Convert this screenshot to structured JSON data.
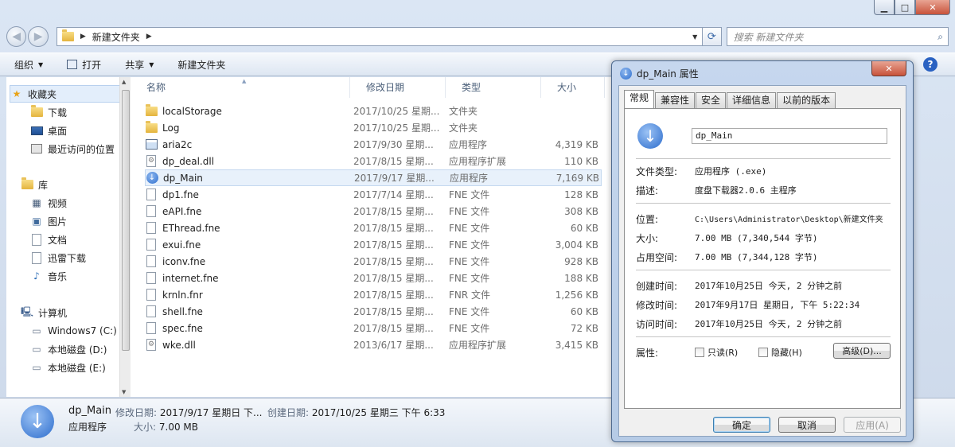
{
  "address": {
    "path": "新建文件夹"
  },
  "search": {
    "placeholder": "搜索 新建文件夹"
  },
  "toolbar": {
    "organize": "组织",
    "open": "打开",
    "share": "共享",
    "new_folder": "新建文件夹"
  },
  "nav": {
    "favorites": "收藏夹",
    "downloads": "下载",
    "desktop": "桌面",
    "recent": "最近访问的位置",
    "libraries": "库",
    "videos": "视频",
    "pictures": "图片",
    "documents": "文档",
    "thunder": "迅雷下载",
    "music": "音乐",
    "computer": "计算机",
    "drive_c": "Windows7 (C:)",
    "drive_d": "本地磁盘 (D:)",
    "drive_e": "本地磁盘 (E:)"
  },
  "columns": {
    "name": "名称",
    "date": "修改日期",
    "type": "类型",
    "size": "大小"
  },
  "files": [
    {
      "name": "localStorage",
      "date": "2017/10/25 星期...",
      "type": "文件夹",
      "size": "",
      "icon": "folder-icon"
    },
    {
      "name": "Log",
      "date": "2017/10/25 星期...",
      "type": "文件夹",
      "size": "",
      "icon": "folder-icon"
    },
    {
      "name": "aria2c",
      "date": "2017/9/30 星期...",
      "type": "应用程序",
      "size": "4,319 KB",
      "icon": "application-icon"
    },
    {
      "name": "dp_deal.dll",
      "date": "2017/8/15 星期...",
      "type": "应用程序扩展",
      "size": "110 KB",
      "icon": "dll-icon"
    },
    {
      "name": "dp_Main",
      "date": "2017/9/17 星期...",
      "type": "应用程序",
      "size": "7,169 KB",
      "icon": "download-app-icon"
    },
    {
      "name": "dp1.fne",
      "date": "2017/7/14 星期...",
      "type": "FNE 文件",
      "size": "128 KB",
      "icon": "file-icon"
    },
    {
      "name": "eAPI.fne",
      "date": "2017/8/15 星期...",
      "type": "FNE 文件",
      "size": "308 KB",
      "icon": "file-icon"
    },
    {
      "name": "EThread.fne",
      "date": "2017/8/15 星期...",
      "type": "FNE 文件",
      "size": "60 KB",
      "icon": "file-icon"
    },
    {
      "name": "exui.fne",
      "date": "2017/8/15 星期...",
      "type": "FNE 文件",
      "size": "3,004 KB",
      "icon": "file-icon"
    },
    {
      "name": "iconv.fne",
      "date": "2017/8/15 星期...",
      "type": "FNE 文件",
      "size": "928 KB",
      "icon": "file-icon"
    },
    {
      "name": "internet.fne",
      "date": "2017/8/15 星期...",
      "type": "FNE 文件",
      "size": "188 KB",
      "icon": "file-icon"
    },
    {
      "name": "krnln.fnr",
      "date": "2017/8/15 星期...",
      "type": "FNR 文件",
      "size": "1,256 KB",
      "icon": "file-icon"
    },
    {
      "name": "shell.fne",
      "date": "2017/8/15 星期...",
      "type": "FNE 文件",
      "size": "60 KB",
      "icon": "file-icon"
    },
    {
      "name": "spec.fne",
      "date": "2017/8/15 星期...",
      "type": "FNE 文件",
      "size": "72 KB",
      "icon": "file-icon"
    },
    {
      "name": "wke.dll",
      "date": "2013/6/17 星期...",
      "type": "应用程序扩展",
      "size": "3,415 KB",
      "icon": "dll-icon"
    }
  ],
  "details": {
    "name": "dp_Main",
    "type": "应用程序",
    "modified_label": "修改日期:",
    "modified": "2017/9/17 星期日 下...",
    "created_label": "创建日期:",
    "created": "2017/10/25 星期三 下午 6:33",
    "size_label": "大小:",
    "size": "7.00 MB"
  },
  "dialog": {
    "title": "dp_Main 属性",
    "tabs": [
      "常规",
      "兼容性",
      "安全",
      "详细信息",
      "以前的版本"
    ],
    "filename": "dp_Main",
    "rows": {
      "type_k": "文件类型:",
      "type_v": "应用程序 (.exe)",
      "desc_k": "描述:",
      "desc_v": "度盘下载器2.0.6 主程序",
      "loc_k": "位置:",
      "loc_v": "C:\\Users\\Administrator\\Desktop\\新建文件夹",
      "size_k": "大小:",
      "size_v": "7.00 MB (7,340,544 字节)",
      "disk_k": "占用空间:",
      "disk_v": "7.00 MB (7,344,128 字节)",
      "created_k": "创建时间:",
      "created_v": "2017年10月25日 今天, 2 分钟之前",
      "modified_k": "修改时间:",
      "modified_v": "2017年9月17日 星期日, 下午 5:22:34",
      "accessed_k": "访问时间:",
      "accessed_v": "2017年10月25日 今天, 2 分钟之前",
      "attr_k": "属性:"
    },
    "readonly": "只读(R)",
    "hidden": "隐藏(H)",
    "advanced": "高级(D)...",
    "ok": "确定",
    "cancel": "取消",
    "apply": "应用(A)"
  }
}
